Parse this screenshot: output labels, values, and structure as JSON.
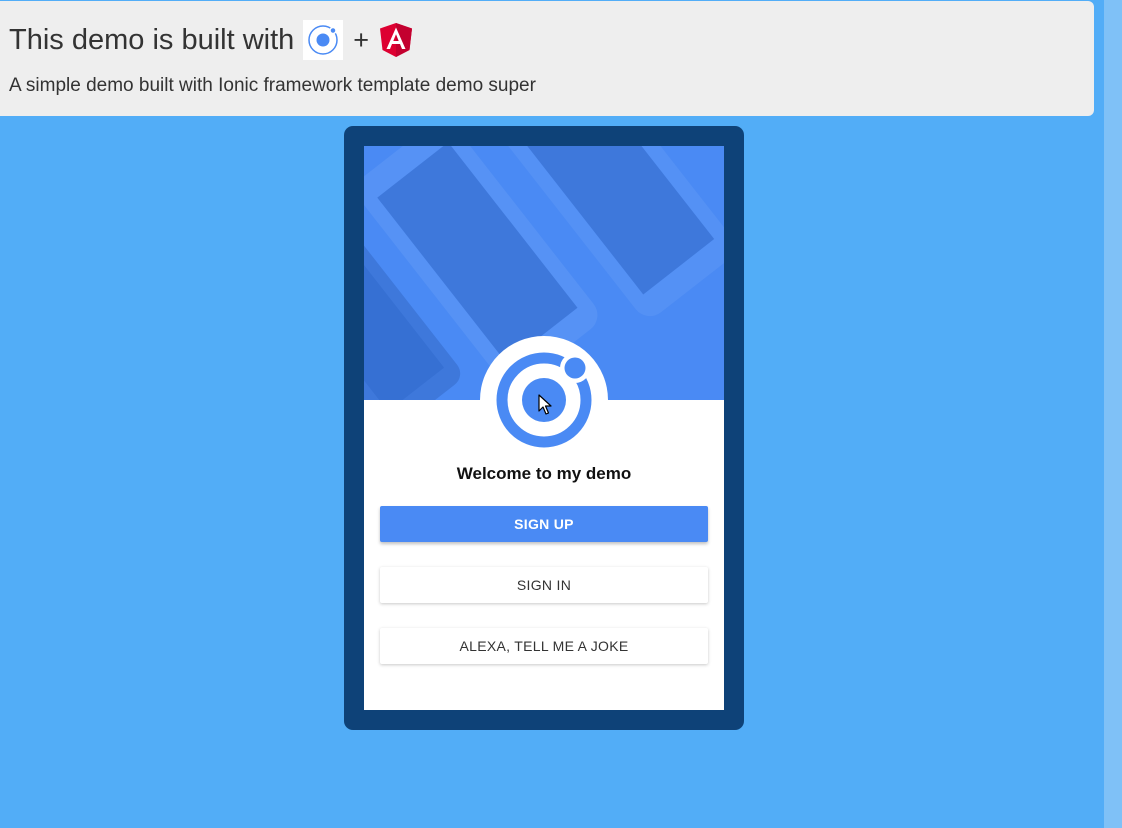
{
  "banner": {
    "title_prefix": "This demo is built with",
    "plus": "+",
    "subtitle": "A simple demo built with Ionic framework template demo super",
    "icons": [
      "ionic-logo-icon",
      "angular-logo-icon"
    ]
  },
  "app": {
    "welcome": "Welcome to my demo",
    "buttons": {
      "sign_up": "SIGN UP",
      "sign_in": "SIGN IN",
      "joke": "ALEXA, TELL ME A JOKE"
    },
    "logo_icon": "ionic-logo-icon"
  },
  "colors": {
    "page_background": "#52adf7",
    "banner_background": "#eeeeee",
    "device_frame": "#0e4278",
    "primary": "#4a8af4",
    "angular_red": "#dd0031"
  }
}
